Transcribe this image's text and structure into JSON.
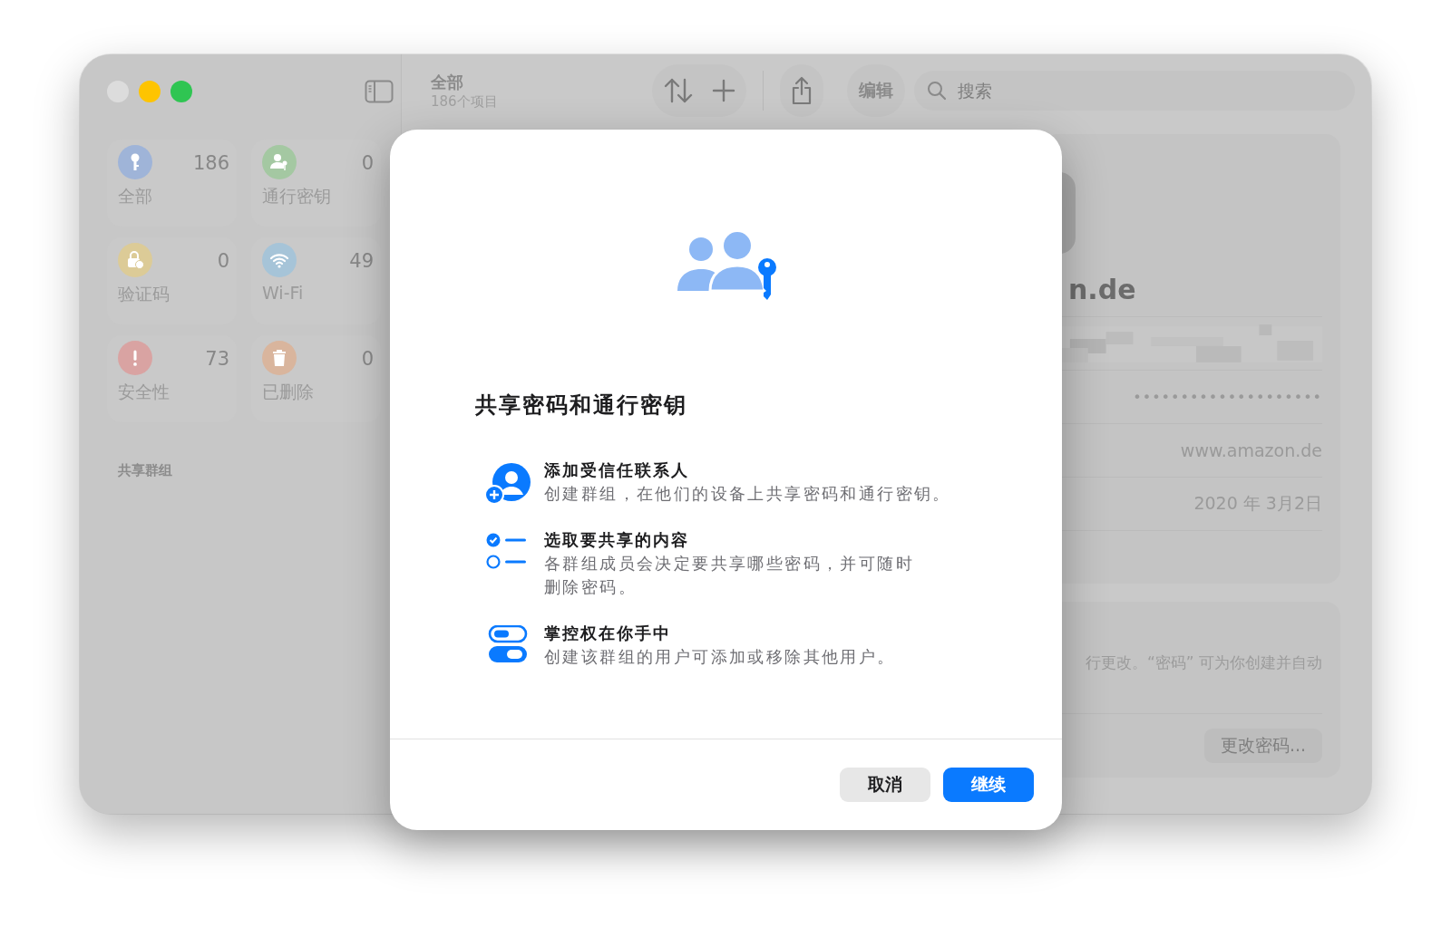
{
  "window": {
    "traffic_lights": [
      {
        "color": "#dcdcdc"
      },
      {
        "color": "#fec400"
      },
      {
        "color": "#2fc552"
      }
    ]
  },
  "sidebar": {
    "categories": [
      {
        "kind": "all",
        "label": "全部",
        "count": "186",
        "color": "#9fb4d8"
      },
      {
        "kind": "passkeys",
        "label": "通行密钥",
        "count": "0",
        "color": "#a4c8a2"
      },
      {
        "kind": "codes",
        "label": "验证码",
        "count": "0",
        "color": "#dccb97"
      },
      {
        "kind": "wifi",
        "label": "Wi-Fi",
        "count": "49",
        "color": "#a6c4d8"
      },
      {
        "kind": "security",
        "label": "安全性",
        "count": "73",
        "color": "#d9a3a2"
      },
      {
        "kind": "deleted",
        "label": "已删除",
        "count": "0",
        "color": "#d9b59d"
      }
    ],
    "section_header": "共享群组"
  },
  "toolbar": {
    "title": "全部",
    "subtitle": "186个项目",
    "edit_button": "编辑",
    "search_placeholder": "搜索"
  },
  "detail": {
    "title": "n.de",
    "password": "••••••••••••••••••••",
    "website": "www.amazon.de",
    "date": "2020 年 3月2日",
    "note": "行更改。“密码” 可为你创建并自动",
    "change_password_button": "更改密码..."
  },
  "dialog": {
    "title": "共享密码和通行密钥",
    "items": [
      {
        "kind": "contact",
        "title": "添加受信任联系人",
        "description": "创建群组，在他们的设备上共享密码和通行密钥。"
      },
      {
        "kind": "checklist",
        "title": "选取要共享的内容",
        "description": "各群组成员会决定要共享哪些密码，并可随时删除密码。"
      },
      {
        "kind": "toggles",
        "title": "掌控权在你手中",
        "description": "创建该群组的用户可添加或移除其他用户。"
      }
    ],
    "buttons": [
      {
        "label": "取消",
        "default": false
      },
      {
        "label": "继续",
        "default": true
      }
    ]
  }
}
